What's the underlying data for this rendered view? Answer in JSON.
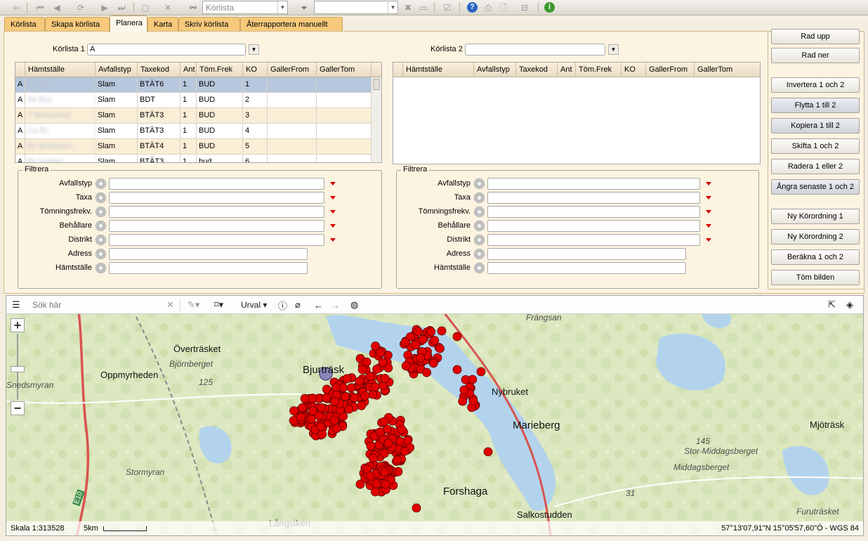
{
  "toolbar": {
    "search_combo": "Körlista",
    "filter_value": ""
  },
  "tabs": [
    {
      "label": "Körlista"
    },
    {
      "label": "Skapa körlista"
    },
    {
      "label": "Planera",
      "active": true
    },
    {
      "label": "Karta"
    },
    {
      "label": "Skriv körlista"
    },
    {
      "label": "Återrapportera manuellt"
    }
  ],
  "list1": {
    "label": "Körlista 1",
    "value": "A"
  },
  "list2": {
    "label": "Körlista 2",
    "value": ""
  },
  "grid_columns": [
    "Hämtställe",
    "Avfallstyp",
    "Taxekod",
    "Ant",
    "Töm.Frek",
    "KO",
    "GallerFrom",
    "GallerTom"
  ],
  "grid1_rows": [
    {
      "list": "A",
      "place": "Ab Bcs",
      "waste": "Slam",
      "code": "BTÄT6",
      "qty": "1",
      "freq": "BUD",
      "ko": "1",
      "from": "",
      "to": ""
    },
    {
      "list": "A",
      "place": "Ae Bcs",
      "waste": "Slam",
      "code": "BDT",
      "qty": "1",
      "freq": "BUD",
      "ko": "2",
      "from": "",
      "to": ""
    },
    {
      "list": "A",
      "place": "T Bcbouman",
      "waste": "Slam",
      "code": "BTÄT3",
      "qty": "1",
      "freq": "BUD",
      "ko": "3",
      "from": "",
      "to": ""
    },
    {
      "list": "A",
      "place": "Ca Bc",
      "waste": "Slam",
      "code": "BTÄT3",
      "qty": "1",
      "freq": "BUD",
      "ko": "4",
      "from": "",
      "to": ""
    },
    {
      "list": "A",
      "place": "Ek Brdbarton",
      "waste": "Slam",
      "code": "BTÄT4",
      "qty": "1",
      "freq": "BUD",
      "ko": "5",
      "from": "",
      "to": ""
    },
    {
      "list": "A",
      "place": "Ek Sorden",
      "waste": "Slam",
      "code": "BTÄT3",
      "qty": "1",
      "freq": "bud",
      "ko": "6",
      "from": "",
      "to": ""
    }
  ],
  "filter": {
    "legend": "Filtrera",
    "fields": [
      "Avfallstyp",
      "Taxa",
      "Tömningsfrekv.",
      "Behållare",
      "Distrikt",
      "Adress",
      "Hämtställe"
    ]
  },
  "buttons": [
    "Rad upp",
    "Rad ner",
    "Invertera 1 och 2",
    "Flytta 1 till 2",
    "Kopiera 1 till 2",
    "Skifta 1 och 2",
    "Radera 1 eller 2",
    "Ångra senaste 1 och 2",
    "Ny Körordning 1",
    "Ny Körordning 2",
    "Beräkna 1 och 2",
    "Töm bilden"
  ],
  "map": {
    "search_placeholder": "Sök här",
    "selection_label": "Urval",
    "places": [
      "Frängsan",
      "Överträsket",
      "Björnberget",
      "Oppmyrheden",
      "Snedsmyran",
      "125",
      "Bjurträsk",
      "Nybruket",
      "Marieberg",
      "Mjöträsk",
      "145",
      "Stor-Middagsberget",
      "Middagsberget",
      "Stormyran",
      "Forshaga",
      "Salkostudden",
      "31",
      "Furuträsket",
      "Långviken",
      "E10"
    ],
    "scale_label": "Skala 1:313528",
    "scale_bar_label": "5km",
    "coordinates": "57°13'07,91\"N 15°05'57,60\"Ö - WGS 84"
  },
  "colors": {
    "tab": "#f6c97c",
    "panel": "#fdf3e1",
    "selected_row": "#b7c7dd",
    "marker": "#e00000",
    "road": "#d9534f",
    "water": "#b3d3ec"
  }
}
